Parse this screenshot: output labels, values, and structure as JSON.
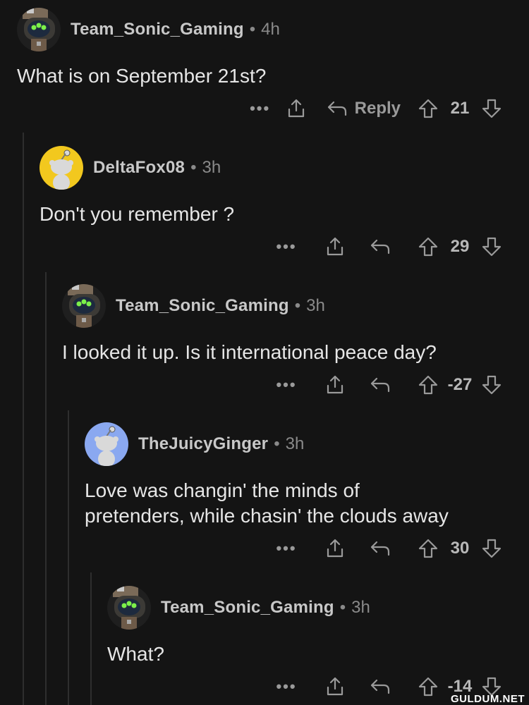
{
  "comments": [
    {
      "username": "Team_Sonic_Gaming",
      "separator": "•",
      "age": "4h",
      "avatar": "robot-avatar",
      "text": "What is on September 21st?",
      "more": "•••",
      "reply_label": "Reply",
      "score": "21"
    },
    {
      "username": "DeltaFox08",
      "separator": "•",
      "age": "3h",
      "avatar": "snoo-yellow-avatar",
      "text": "Don't you remember ?",
      "more": "•••",
      "reply_label": "",
      "score": "29"
    },
    {
      "username": "Team_Sonic_Gaming",
      "separator": "•",
      "age": "3h",
      "avatar": "robot-avatar",
      "text": "I looked it up. Is it international peace day?",
      "more": "•••",
      "reply_label": "",
      "score": "-27"
    },
    {
      "username": "TheJuicyGinger",
      "separator": "•",
      "age": "3h",
      "avatar": "snoo-blue-avatar",
      "text": "Love was changin' the minds of\npretenders, while chasin' the clouds away",
      "more": "•••",
      "reply_label": "",
      "score": "30"
    },
    {
      "username": "Team_Sonic_Gaming",
      "separator": "•",
      "age": "3h",
      "avatar": "robot-avatar",
      "text": "What?",
      "more": "•••",
      "reply_label": "",
      "score": "-14"
    }
  ],
  "watermark": "GULDUM.NET",
  "colors": {
    "background": "#141414",
    "text": "#e6e6e6",
    "muted": "#8a8a8a",
    "thread_line": "#2e2e2e",
    "snoo_yellow": "#f2c81e",
    "snoo_blue": "#8aa8f0"
  }
}
